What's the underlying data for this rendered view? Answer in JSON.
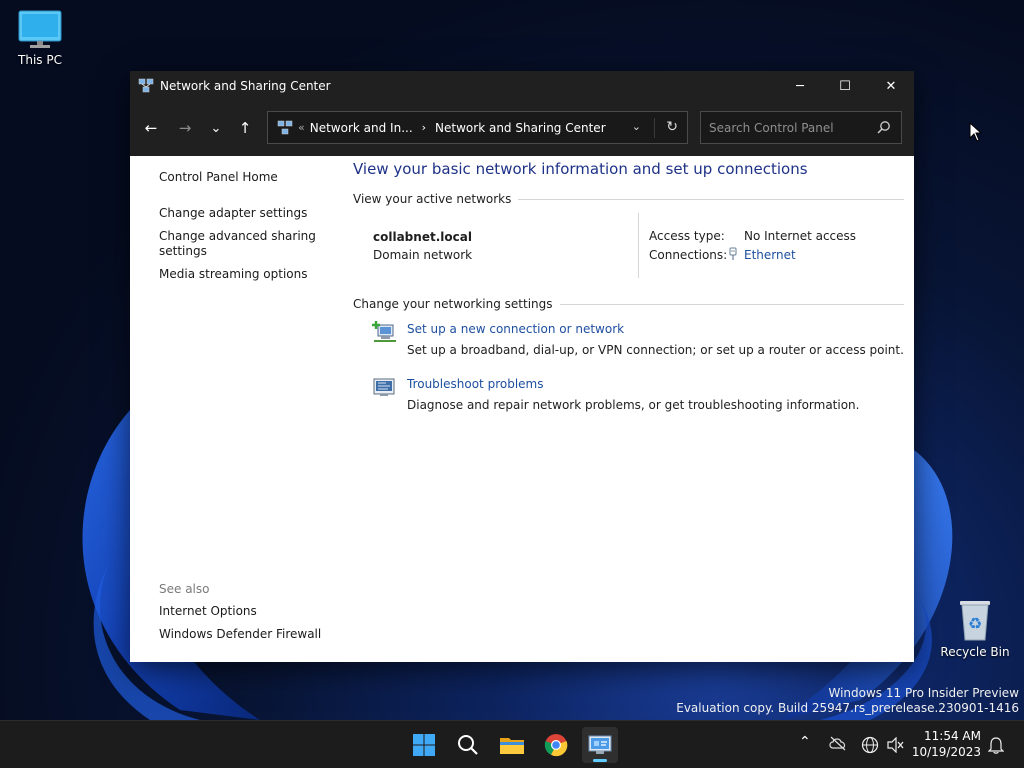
{
  "desktop": {
    "icons": [
      {
        "label": "This PC",
        "icon": "monitor-icon"
      },
      {
        "label": "Recycle Bin",
        "icon": "recycle-bin-icon"
      }
    ],
    "watermark": {
      "line1": "Windows 11 Pro Insider Preview",
      "line2": "Evaluation copy. Build 25947.rs_prerelease.230901-1416"
    }
  },
  "window": {
    "title": "Network and Sharing Center",
    "controls": {
      "minimize": "─",
      "maximize": "☐",
      "close": "✕"
    },
    "nav": {
      "back": "←",
      "forward": "→",
      "recent": "⌄",
      "up": "↑"
    },
    "address": {
      "overflow": "«",
      "crumbs": [
        "Network and In...",
        "Network and Sharing Center"
      ],
      "separator": "›"
    },
    "search": {
      "placeholder": "Search Control Panel"
    }
  },
  "left_pane": {
    "links": [
      "Control Panel Home",
      "Change adapter settings",
      "Change advanced sharing settings",
      "Media streaming options"
    ],
    "see_also_heading": "See also",
    "see_also": [
      "Internet Options",
      "Windows Defender Firewall"
    ]
  },
  "main": {
    "heading": "View your basic network information and set up connections",
    "active_networks_heading": "View your active networks",
    "network": {
      "name": "collabnet.local",
      "type": "Domain network",
      "access_label": "Access type:",
      "access_value": "No Internet access",
      "connections_label": "Connections:",
      "connections_value": "Ethernet"
    },
    "change_heading": "Change your networking settings",
    "tasks": [
      {
        "title": "Set up a new connection or network",
        "desc": "Set up a broadband, dial-up, or VPN connection; or set up a router or access point.",
        "icon": "new-connection-icon"
      },
      {
        "title": "Troubleshoot problems",
        "desc": "Diagnose and repair network problems, or get troubleshooting information.",
        "icon": "troubleshoot-icon"
      }
    ]
  },
  "taskbar": {
    "apps": [
      "start",
      "search",
      "file-explorer",
      "chrome",
      "control-panel"
    ],
    "time": "11:54 AM",
    "date": "10/19/2023"
  }
}
